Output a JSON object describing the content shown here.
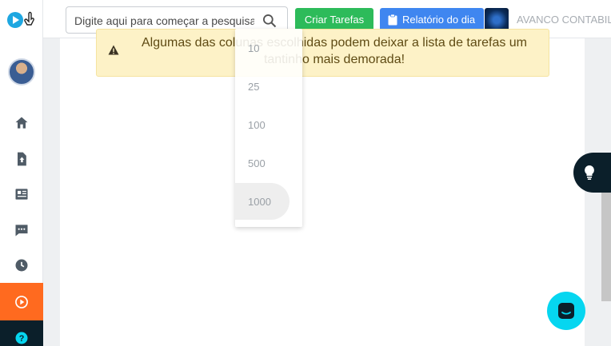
{
  "topbar": {
    "search_placeholder": "Digite aqui para começar a pesquisa...",
    "create_tasks_label": "Criar Tarefas",
    "daily_report_label": "Relatório do dia",
    "company_name": "AVANCO CONTABIL"
  },
  "alert": {
    "message": "Algumas das colunas escolhidas podem deixar a lista de tarefas um tantinho mais demorada!"
  },
  "page_size_dropdown": {
    "options": [
      "10",
      "25",
      "100",
      "500",
      "1000"
    ],
    "selected": "1000"
  },
  "sidebar": {
    "items": [
      "home-icon",
      "upload-icon",
      "news-icon",
      "chat-bubble-icon",
      "clock-icon",
      "play-icon",
      "help-icon"
    ],
    "active_item": "play-icon"
  },
  "colors": {
    "accent_orange": "#ff6a1f",
    "green_button": "#2dbb5a",
    "blue_button": "#3f86f0",
    "chat_cyan": "#06d6f0",
    "alert_bg": "#fdf2c7"
  }
}
